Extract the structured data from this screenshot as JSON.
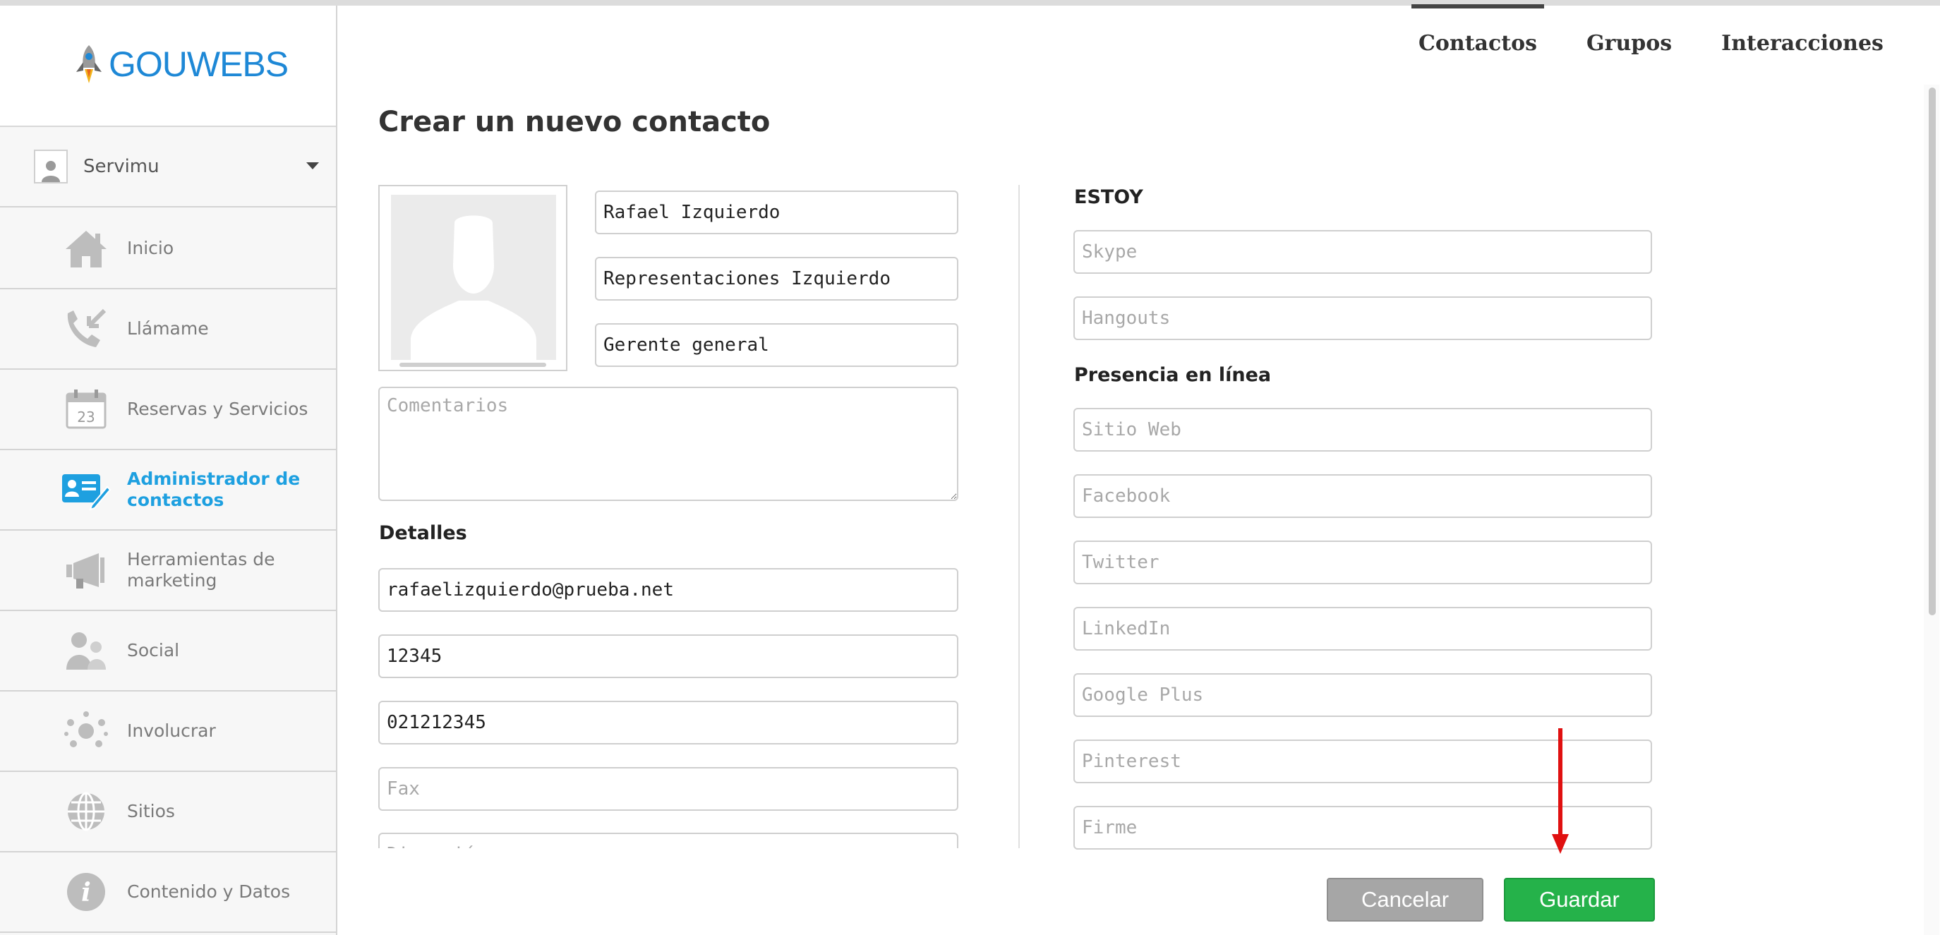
{
  "app": {
    "logo_text": "GOUWEBS",
    "brand_color": "#1e88d6",
    "accent_active": "#1ea0e0",
    "save_color": "#25b24a",
    "cancel_color": "#a6a6a6"
  },
  "user": {
    "name": "Servimu"
  },
  "sidebar": {
    "items": [
      {
        "label": "Inicio",
        "icon": "home-icon"
      },
      {
        "label": "Llámame",
        "icon": "call-icon"
      },
      {
        "label": "Reservas y Servicios",
        "icon": "calendar-icon",
        "calendar_day": "23"
      },
      {
        "label": "Administrador de contactos",
        "icon": "contact-card-icon",
        "active": true
      },
      {
        "label": "Herramientas de marketing",
        "icon": "megaphone-icon"
      },
      {
        "label": "Social",
        "icon": "people-icon"
      },
      {
        "label": "Involucrar",
        "icon": "network-icon"
      },
      {
        "label": "Sitios",
        "icon": "globe-icon"
      },
      {
        "label": "Contenido y Datos",
        "icon": "info-icon"
      }
    ]
  },
  "tabs": [
    {
      "label": "Contactos",
      "active": true
    },
    {
      "label": "Grupos"
    },
    {
      "label": "Interacciones"
    }
  ],
  "page": {
    "title": "Crear un nuevo contacto"
  },
  "form": {
    "name": {
      "value": "Rafael Izquierdo"
    },
    "company": {
      "value": "Representaciones Izquierdo"
    },
    "position": {
      "value": "Gerente general"
    },
    "comments": {
      "placeholder": "Comentarios",
      "value": ""
    },
    "details_label": "Detalles",
    "email": {
      "value": "rafaelizquierdo@prueba.net"
    },
    "phone": {
      "value": "12345"
    },
    "mobile": {
      "value": "021212345"
    },
    "fax": {
      "placeholder": "Fax",
      "value": ""
    },
    "address": {
      "placeholder": "Dirección",
      "value": ""
    },
    "estoy_label": "ESTOY",
    "skype": {
      "placeholder": "Skype"
    },
    "hangouts": {
      "placeholder": "Hangouts"
    },
    "presence_label": "Presencia en línea",
    "website": {
      "placeholder": "Sitio Web"
    },
    "facebook": {
      "placeholder": "Facebook"
    },
    "twitter": {
      "placeholder": "Twitter"
    },
    "linkedin": {
      "placeholder": "LinkedIn"
    },
    "googleplus": {
      "placeholder": "Google Plus"
    },
    "pinterest": {
      "placeholder": "Pinterest"
    },
    "signature": {
      "placeholder": "Firme"
    }
  },
  "buttons": {
    "cancel": "Cancelar",
    "save": "Guardar"
  },
  "annotation": {
    "arrow_color": "#e01010"
  }
}
